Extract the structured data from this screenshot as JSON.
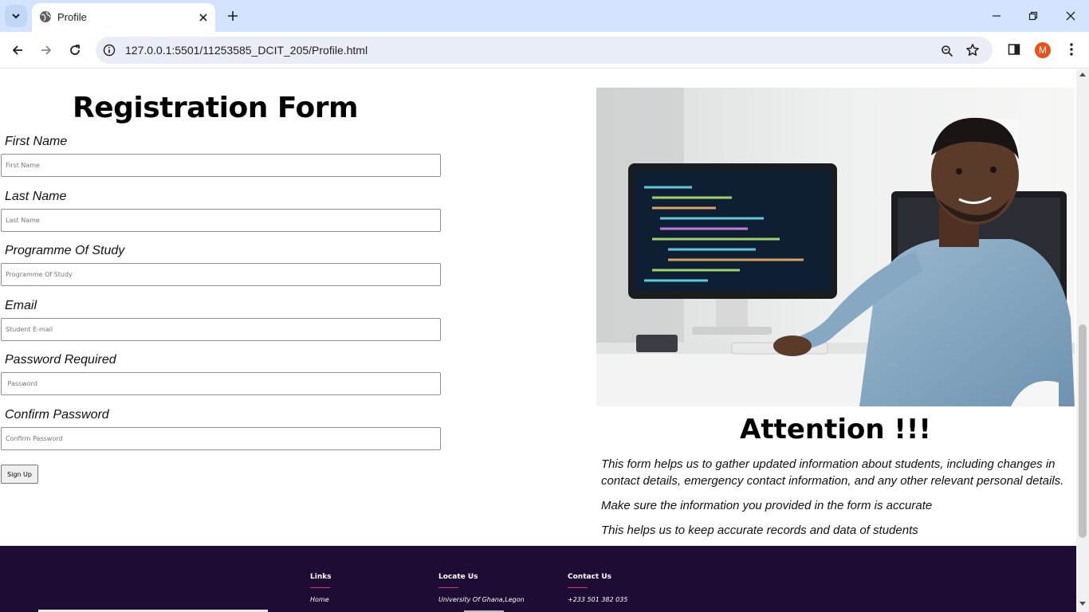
{
  "browser": {
    "tab_title": "Profile",
    "url": "127.0.0.1:5501/11253585_DCIT_205/Profile.html",
    "profile_initial": "M"
  },
  "form": {
    "title": "Registration Form",
    "fields": [
      {
        "label": "First Name",
        "placeholder": "First Name"
      },
      {
        "label": "Last Name",
        "placeholder": "Last Name"
      },
      {
        "label": "Programme Of Study",
        "placeholder": "Programme Of Study"
      },
      {
        "label": "Email",
        "placeholder": "Student E-mail"
      },
      {
        "label": "Password Required",
        "placeholder": " Password"
      },
      {
        "label": "Confirm Password",
        "placeholder": "Confirm Password"
      }
    ],
    "submit_label": "Sign Up"
  },
  "attention": {
    "heading": "Attention !!!",
    "paragraphs": [
      "This form helps us to gather updated information about students, including changes in contact details, emergency contact information, and any other relevant personal details.",
      "Make sure the information you provided in the form is accurate",
      "This helps us to keep accurate records and data of students"
    ]
  },
  "footer": {
    "columns": [
      {
        "heading": "Links",
        "item": "Home"
      },
      {
        "heading": "Locate Us",
        "item": "University Of Ghana,Legon"
      },
      {
        "heading": "Contact Us",
        "item": "+233 501 382 035"
      }
    ]
  },
  "colors": {
    "footer_bg": "#1d0c33",
    "footer_accent": "#e0306f",
    "tabbar_bg": "#d3e3fd",
    "omnibox_bg": "#e9eef6",
    "avatar_bg": "#e8501c"
  },
  "icons": [
    "tab-search-icon",
    "globe-icon",
    "close-icon",
    "plus-icon",
    "minimize-icon",
    "restore-icon",
    "back-arrow-icon",
    "forward-arrow-icon",
    "reload-icon",
    "info-icon",
    "zoom-icon",
    "star-icon",
    "side-panel-icon",
    "kebab-menu-icon"
  ]
}
